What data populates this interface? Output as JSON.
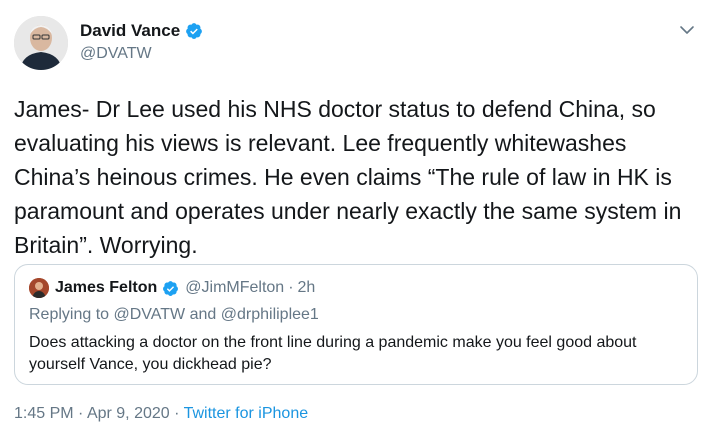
{
  "author": {
    "name": "David Vance",
    "handle": "@DVATW",
    "avatar_icon": "person-avatar",
    "verified_icon": "verified-badge-icon"
  },
  "tweet": {
    "text": "James- Dr Lee used his NHS doctor status to defend China, so evaluating his views is relevant. Lee frequently whitewashes China’s heinous crimes. He even claims “The rule of law in HK is paramount and operates under nearly exactly the same system in Britain”. Worrying."
  },
  "quoted_tweet": {
    "name": "James Felton",
    "handle": "@JimMFelton",
    "separator": "·",
    "time": "2h",
    "replying_prefix": "Replying to",
    "mention_1": "@DVATW",
    "replying_and": "and",
    "mention_2": "@drphiliplee1",
    "text": "Does attacking a doctor on the front line during a pandemic make you feel good about yourself Vance, you dickhead pie?"
  },
  "meta": {
    "time": "1:45 PM",
    "separator_1": "·",
    "date": "Apr 9, 2020",
    "separator_2": "·",
    "source": "Twitter for iPhone"
  },
  "colors": {
    "accent": "#1b95e0",
    "muted": "#657786",
    "text": "#14171a",
    "border": "#ccd6dd"
  }
}
